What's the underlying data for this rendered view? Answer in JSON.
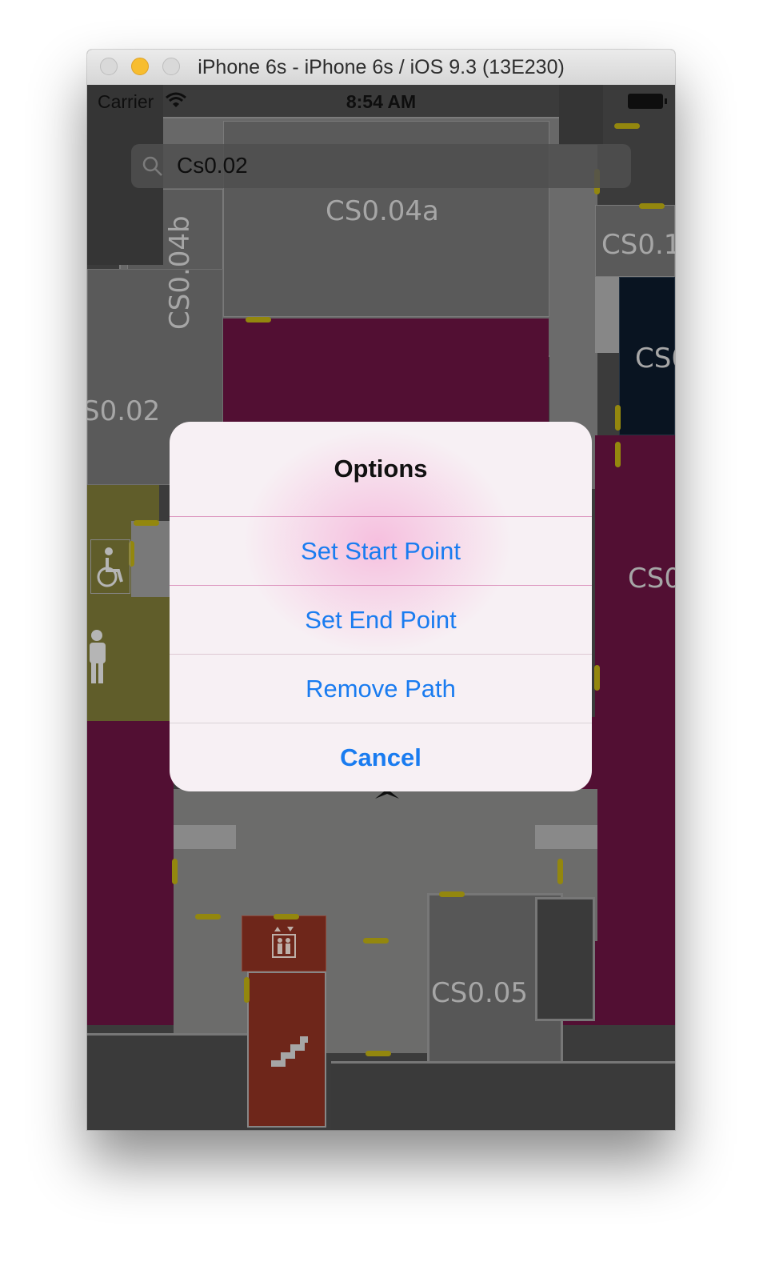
{
  "window": {
    "title": "iPhone 6s - iPhone 6s / iOS 9.3 (13E230)"
  },
  "status_bar": {
    "carrier": "Carrier",
    "time": "8:54 AM"
  },
  "search": {
    "value": "Cs0.02"
  },
  "map": {
    "room_labels": {
      "cs004a": "CS0.04a",
      "cs004b": "CS0.04b",
      "cs002": "S0.02",
      "cs01_top": "CS0.1",
      "cs0_navy": "CS0",
      "cs0_right": "CS0",
      "cs005": "CS0.05"
    },
    "colors": {
      "room_purple": "#5e123b",
      "room_olive": "#6e6a30",
      "room_navy": "#0b1726",
      "room_red": "#7e2c1e",
      "door": "#a89a10"
    }
  },
  "alert": {
    "title": "Options",
    "buttons": [
      {
        "label": "Set Start Point"
      },
      {
        "label": "Set End Point"
      },
      {
        "label": "Remove Path"
      },
      {
        "label": "Cancel"
      }
    ],
    "button_color": "#1a7cf0"
  }
}
